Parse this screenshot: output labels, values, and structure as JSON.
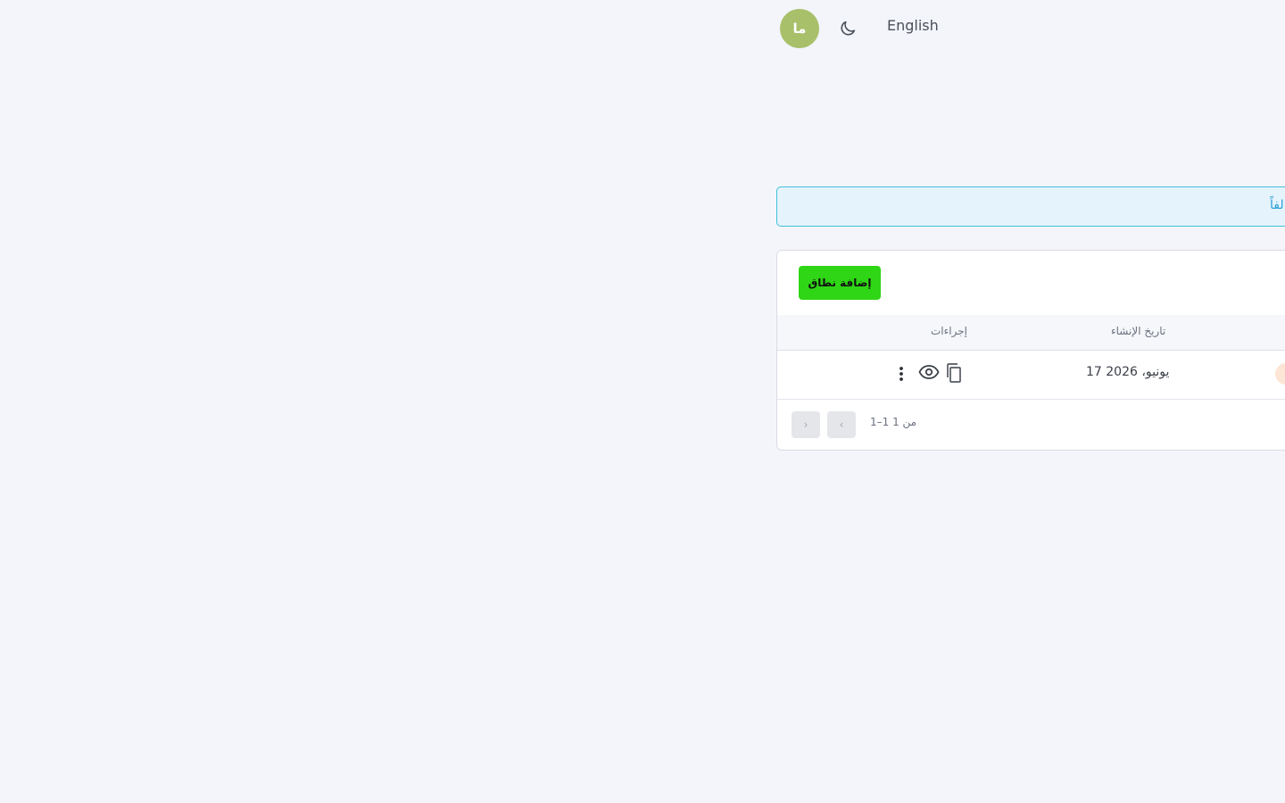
{
  "header": {
    "avatar_initials": "ما",
    "theme_toggle_icon": "moon-icon",
    "language_label": "English"
  },
  "alert": {
    "text": "لفاً."
  },
  "toolbar": {
    "add_domain_label": "إضافة نطاق"
  },
  "table": {
    "columns": {
      "created_at": "تاريخ الإنشاء",
      "actions": "إجراءات"
    },
    "rows": [
      {
        "created_at": "17 يونيو، 2026",
        "actions": [
          "copy-icon",
          "eye-icon",
          "more-vertical-icon"
        ]
      }
    ]
  },
  "pagination": {
    "range_text": "1–1 من 1",
    "prev_label": "‹",
    "next_label": "›"
  },
  "colors": {
    "background": "#f3f5fa",
    "avatar": "#a8c06a",
    "primary_button": "#2fd615",
    "alert_border": "#3ec1d8",
    "alert_background": "#e5f3fc",
    "alert_text": "#2a9fd6"
  }
}
